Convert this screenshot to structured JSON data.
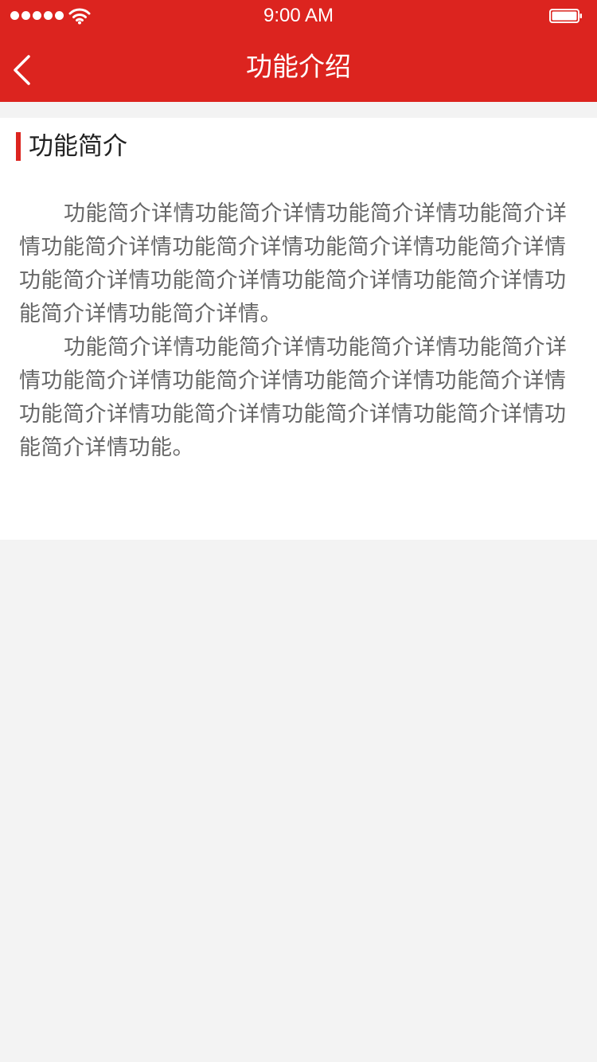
{
  "colors": {
    "brand_red": "#dc241f",
    "background": "#f3f3f3",
    "card": "#ffffff",
    "title_text": "#222222",
    "body_text": "#666666"
  },
  "status_bar": {
    "time": "9:00 AM",
    "signal_icon": "signal-dots-icon",
    "wifi_icon": "wifi-icon",
    "battery_icon": "battery-icon"
  },
  "nav_bar": {
    "back_icon": "chevron-left-icon",
    "title": "功能介绍"
  },
  "section": {
    "title": "功能简介",
    "paragraphs": [
      "功能简介详情功能简介详情功能简介详情功能简介详情功能简介详情功能简介详情功能简介详情功能简介详情功能简介详情功能简介详情功能简介详情功能简介详情功能简介详情功能简介详情。",
      "功能简介详情功能简介详情功能简介详情功能简介详情功能简介详情功能简介详情功能简介详情功能简介详情功能简介详情功能简介详情功能简介详情功能简介详情功能简介详情功能。"
    ]
  }
}
